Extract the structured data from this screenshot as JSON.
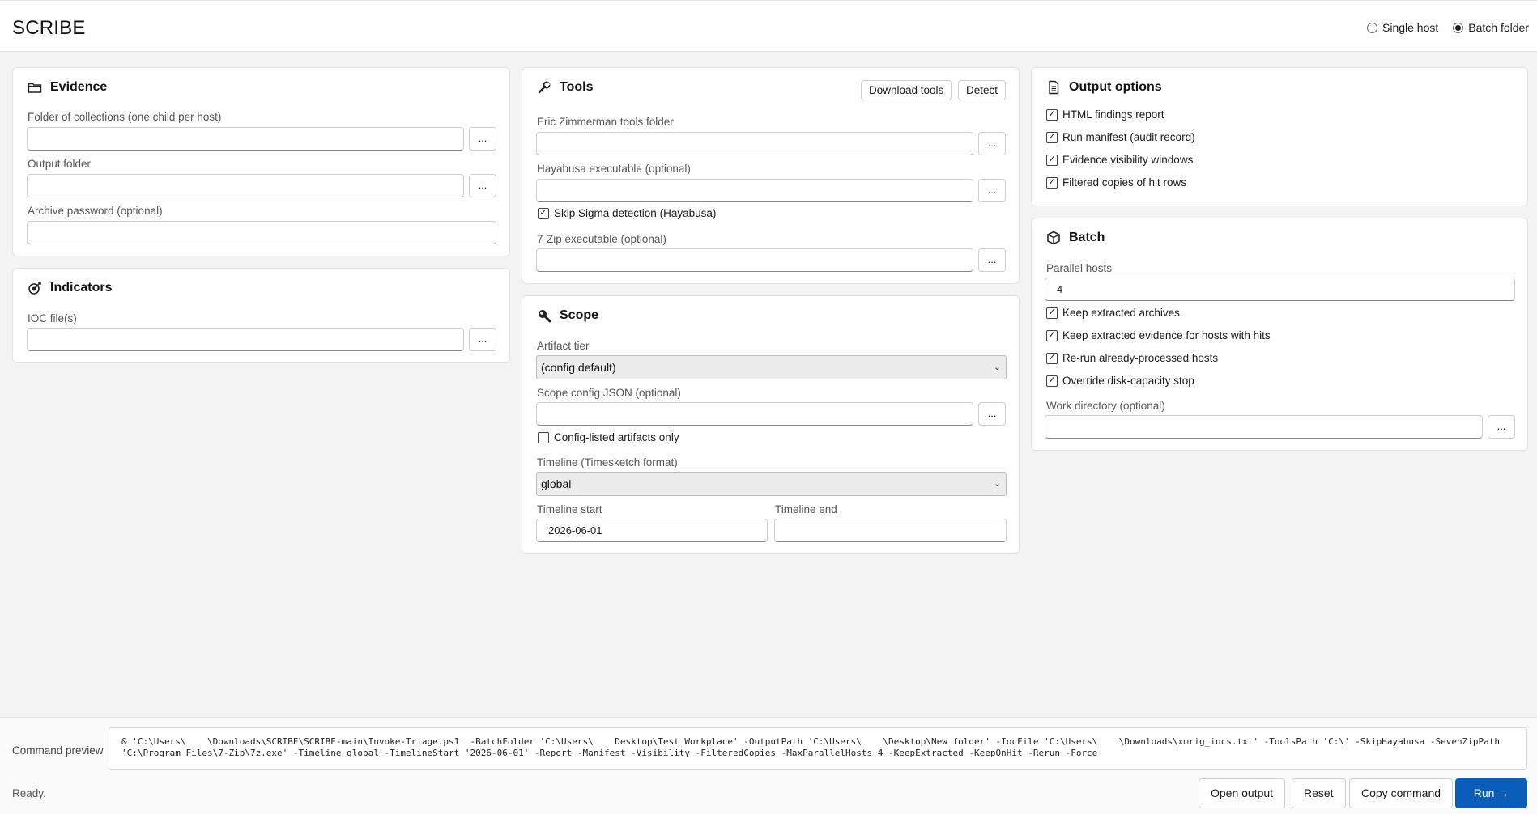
{
  "app": {
    "title": "SCRIBE"
  },
  "mode": {
    "single_label": "Single host",
    "batch_label": "Batch folder",
    "selected": "batch"
  },
  "evidence": {
    "title": "Evidence",
    "folder_label": "Folder of collections (one child per host)",
    "folder_value": "",
    "output_label": "Output folder",
    "output_value": "",
    "password_label": "Archive password (optional)",
    "password_value": ""
  },
  "indicators": {
    "title": "Indicators",
    "ioc_label": "IOC file(s)",
    "ioc_value": ""
  },
  "tools": {
    "title": "Tools",
    "download_label": "Download tools",
    "detect_label": "Detect",
    "ez_label": "Eric Zimmerman tools folder",
    "ez_value": "",
    "hayabusa_label": "Hayabusa executable (optional)",
    "hayabusa_value": "",
    "skip_sigma_label": "Skip Sigma detection (Hayabusa)",
    "skip_sigma_checked": true,
    "sevenzip_label": "7-Zip executable (optional)",
    "sevenzip_value": ""
  },
  "scope": {
    "title": "Scope",
    "tier_label": "Artifact tier",
    "tier_value": "(config default)",
    "config_label": "Scope config JSON (optional)",
    "config_value": "",
    "config_only_label": "Config-listed artifacts only",
    "config_only_checked": false,
    "timeline_label": "Timeline (Timesketch format)",
    "timeline_value": "global",
    "start_label": "Timeline start",
    "start_value": "2026-06-01",
    "end_label": "Timeline end",
    "end_value": ""
  },
  "output_options": {
    "title": "Output options",
    "items": [
      {
        "label": "HTML findings report",
        "checked": true
      },
      {
        "label": "Run manifest (audit record)",
        "checked": true
      },
      {
        "label": "Evidence visibility windows",
        "checked": true
      },
      {
        "label": "Filtered copies of hit rows",
        "checked": true
      }
    ]
  },
  "batch": {
    "title": "Batch",
    "parallel_label": "Parallel hosts",
    "parallel_value": "4",
    "items": [
      {
        "label": "Keep extracted archives",
        "checked": true
      },
      {
        "label": "Keep extracted evidence for hosts with hits",
        "checked": true
      },
      {
        "label": "Re-run already-processed hosts",
        "checked": true
      },
      {
        "label": "Override disk-capacity stop",
        "checked": true
      }
    ],
    "workdir_label": "Work directory (optional)",
    "workdir_value": ""
  },
  "browse_label": "...",
  "footer": {
    "preview_label": "Command preview",
    "command": "& 'C:\\Users\\    \\Downloads\\SCRIBE\\SCRIBE-main\\Invoke-Triage.ps1' -BatchFolder 'C:\\Users\\    Desktop\\Test Workplace' -OutputPath 'C:\\Users\\    \\Desktop\\New folder' -IocFile 'C:\\Users\\    \\Downloads\\xmrig_iocs.txt' -ToolsPath 'C:\\' -SkipHayabusa -SevenZipPath 'C:\\Program Files\\7-Zip\\7z.exe' -Timeline global -TimelineStart '2026-06-01' -Report -Manifest -Visibility -FilteredCopies -MaxParallelHosts 4 -KeepExtracted -KeepOnHit -Rerun -Force",
    "status": "Ready.",
    "open_output_label": "Open output",
    "reset_label": "Reset",
    "copy_label": "Copy command",
    "run_label": "Run →"
  }
}
